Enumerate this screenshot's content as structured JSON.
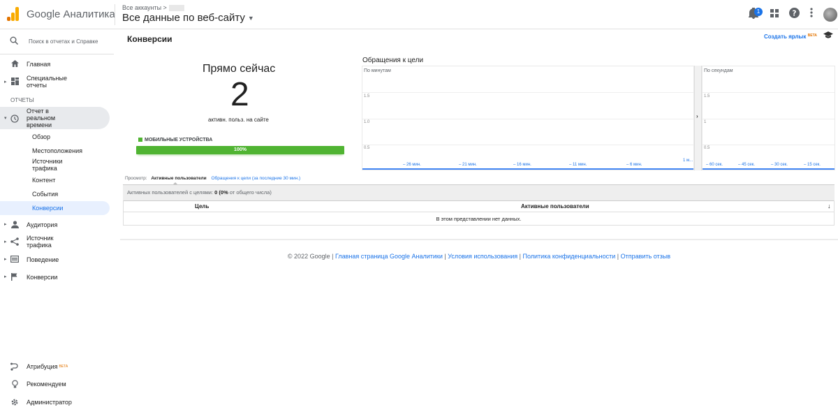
{
  "header": {
    "brand": "Google Аналитика",
    "crumb": "Все аккаунты >",
    "view_name": "Все данные по веб-сайту",
    "notification_count": "1",
    "icons": [
      "bell-icon",
      "apps-icon",
      "help-icon",
      "more-icon",
      "avatar"
    ]
  },
  "sidebar": {
    "search_placeholder": "Поиск в отчетах и Справке",
    "home": "Главная",
    "custom_reports": "Специальные отчеты",
    "section_reports": "ОТЧЕТЫ",
    "realtime": "Отчет в реальном времени",
    "sub": {
      "overview": "Обзор",
      "locations": "Местоположения",
      "traffic_sources": "Источники трафика",
      "content": "Контент",
      "events": "События",
      "conversions": "Конверсии"
    },
    "audience": "Аудитория",
    "acquisition": "Источник трафика",
    "behavior": "Поведение",
    "conversions": "Конверсии",
    "attribution": "Атрибуция",
    "attribution_badge": "BETA",
    "discover": "Рекомендуем",
    "admin": "Администратор"
  },
  "main": {
    "title": "Конверсии",
    "shortcut": "Создать ярлык",
    "shortcut_badge": "BETA",
    "right_now": "Прямо сейчас",
    "active_count": "2",
    "active_label": "активн. польз. на сайте",
    "device_legend": "МОБИЛЬНЫЕ УСТРОЙСТВА",
    "device_percent": "100%",
    "chart_title": "Обращения к цели",
    "per_minute": "По минутам",
    "per_second": "По секундам",
    "min_yticks": [
      "1.5",
      "1.0",
      "0.5"
    ],
    "sec_yticks": [
      "1.5",
      "1",
      "0.5"
    ],
    "min_xticks": [
      "– 26 мин.",
      "– 21 мин.",
      "– 16 мин.",
      "– 11 мин.",
      "– 6 мин.",
      "1 м..."
    ],
    "sec_xticks": [
      "– 60 сек.",
      "– 45 сек.",
      "– 30 сек.",
      "– 15 сек."
    ],
    "view_label": "Просмотр:",
    "view_current": "Активные пользователи",
    "view_link": "Обращения к цели (за последние 30 мин.)",
    "summary_label": "Активных пользователей с целями:",
    "summary_value": "0",
    "summary_pct": "(0%",
    "summary_tail": "от общего числа)",
    "col_goal": "Цель",
    "col_active": "Активные пользователи",
    "empty": "В этом представлении нет данных."
  },
  "footer": {
    "copyright": "© 2022 Google",
    "links": [
      "Главная страница Google Аналитики",
      "Условия использования",
      "Политика конфиденциальности",
      "Отправить отзыв"
    ]
  }
}
